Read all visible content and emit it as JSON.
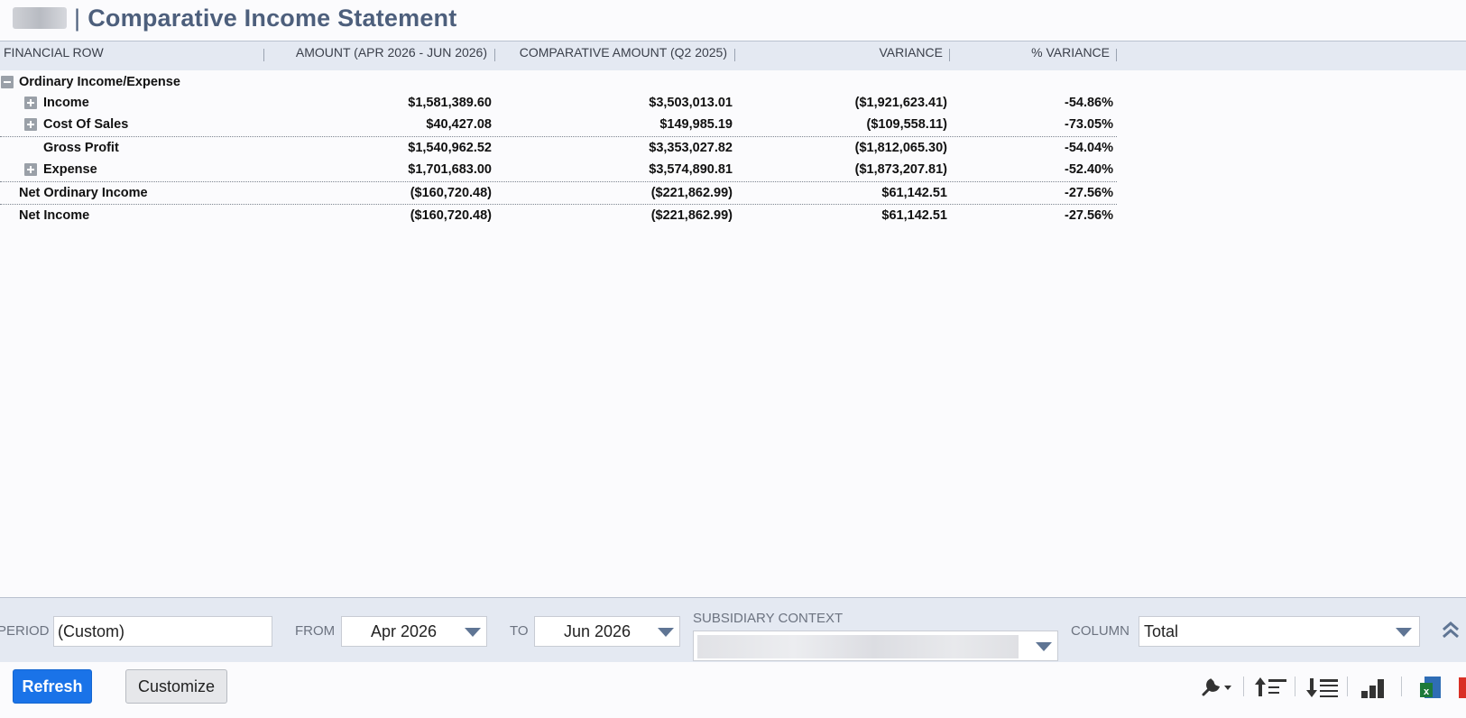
{
  "header": {
    "separator": "|",
    "title": "Comparative Income Statement"
  },
  "columns": [
    "FINANCIAL ROW",
    "AMOUNT (APR 2026 - JUN 2026)",
    "COMPARATIVE AMOUNT (Q2 2025)",
    "VARIANCE",
    "% VARIANCE"
  ],
  "rows": [
    {
      "label": "Ordinary Income/Expense",
      "values": [
        "",
        "",
        "",
        ""
      ]
    },
    {
      "label": "Income",
      "values": [
        "$1,581,389.60",
        "$3,503,013.01",
        "($1,921,623.41)",
        "-54.86%"
      ]
    },
    {
      "label": "Cost Of Sales",
      "values": [
        "$40,427.08",
        "$149,985.19",
        "($109,558.11)",
        "-73.05%"
      ]
    },
    {
      "label": "Gross Profit",
      "values": [
        "$1,540,962.52",
        "$3,353,027.82",
        "($1,812,065.30)",
        "-54.04%"
      ]
    },
    {
      "label": "Expense",
      "values": [
        "$1,701,683.00",
        "$3,574,890.81",
        "($1,873,207.81)",
        "-52.40%"
      ]
    },
    {
      "label": "Net Ordinary Income",
      "values": [
        "($160,720.48)",
        "($221,862.99)",
        "$61,142.51",
        "-27.56%"
      ]
    },
    {
      "label": "Net Income",
      "values": [
        "($160,720.48)",
        "($221,862.99)",
        "$61,142.51",
        "-27.56%"
      ]
    }
  ],
  "filters": {
    "period_label": "PERIOD",
    "period_value": "(Custom)",
    "from_label": "FROM",
    "from_value": "Apr 2026",
    "to_label": "TO",
    "to_value": "Jun 2026",
    "subsidiary_label": "SUBSIDIARY CONTEXT",
    "column_label": "COLUMN",
    "column_value": "Total"
  },
  "actions": {
    "refresh_label": "Refresh",
    "customize_label": "Customize"
  },
  "colors": {
    "title": "#4d5f7c",
    "header_band": "#e4e9f2",
    "primary_button": "#1a73e8",
    "excel_green": "#1d7a3a",
    "pdf_red": "#d93025"
  },
  "icons": [
    "wrench-icon",
    "collapse-all-icon",
    "expand-all-icon",
    "chart-icon",
    "excel-export-icon",
    "pdf-export-icon",
    "chevron-up-double-icon"
  ]
}
